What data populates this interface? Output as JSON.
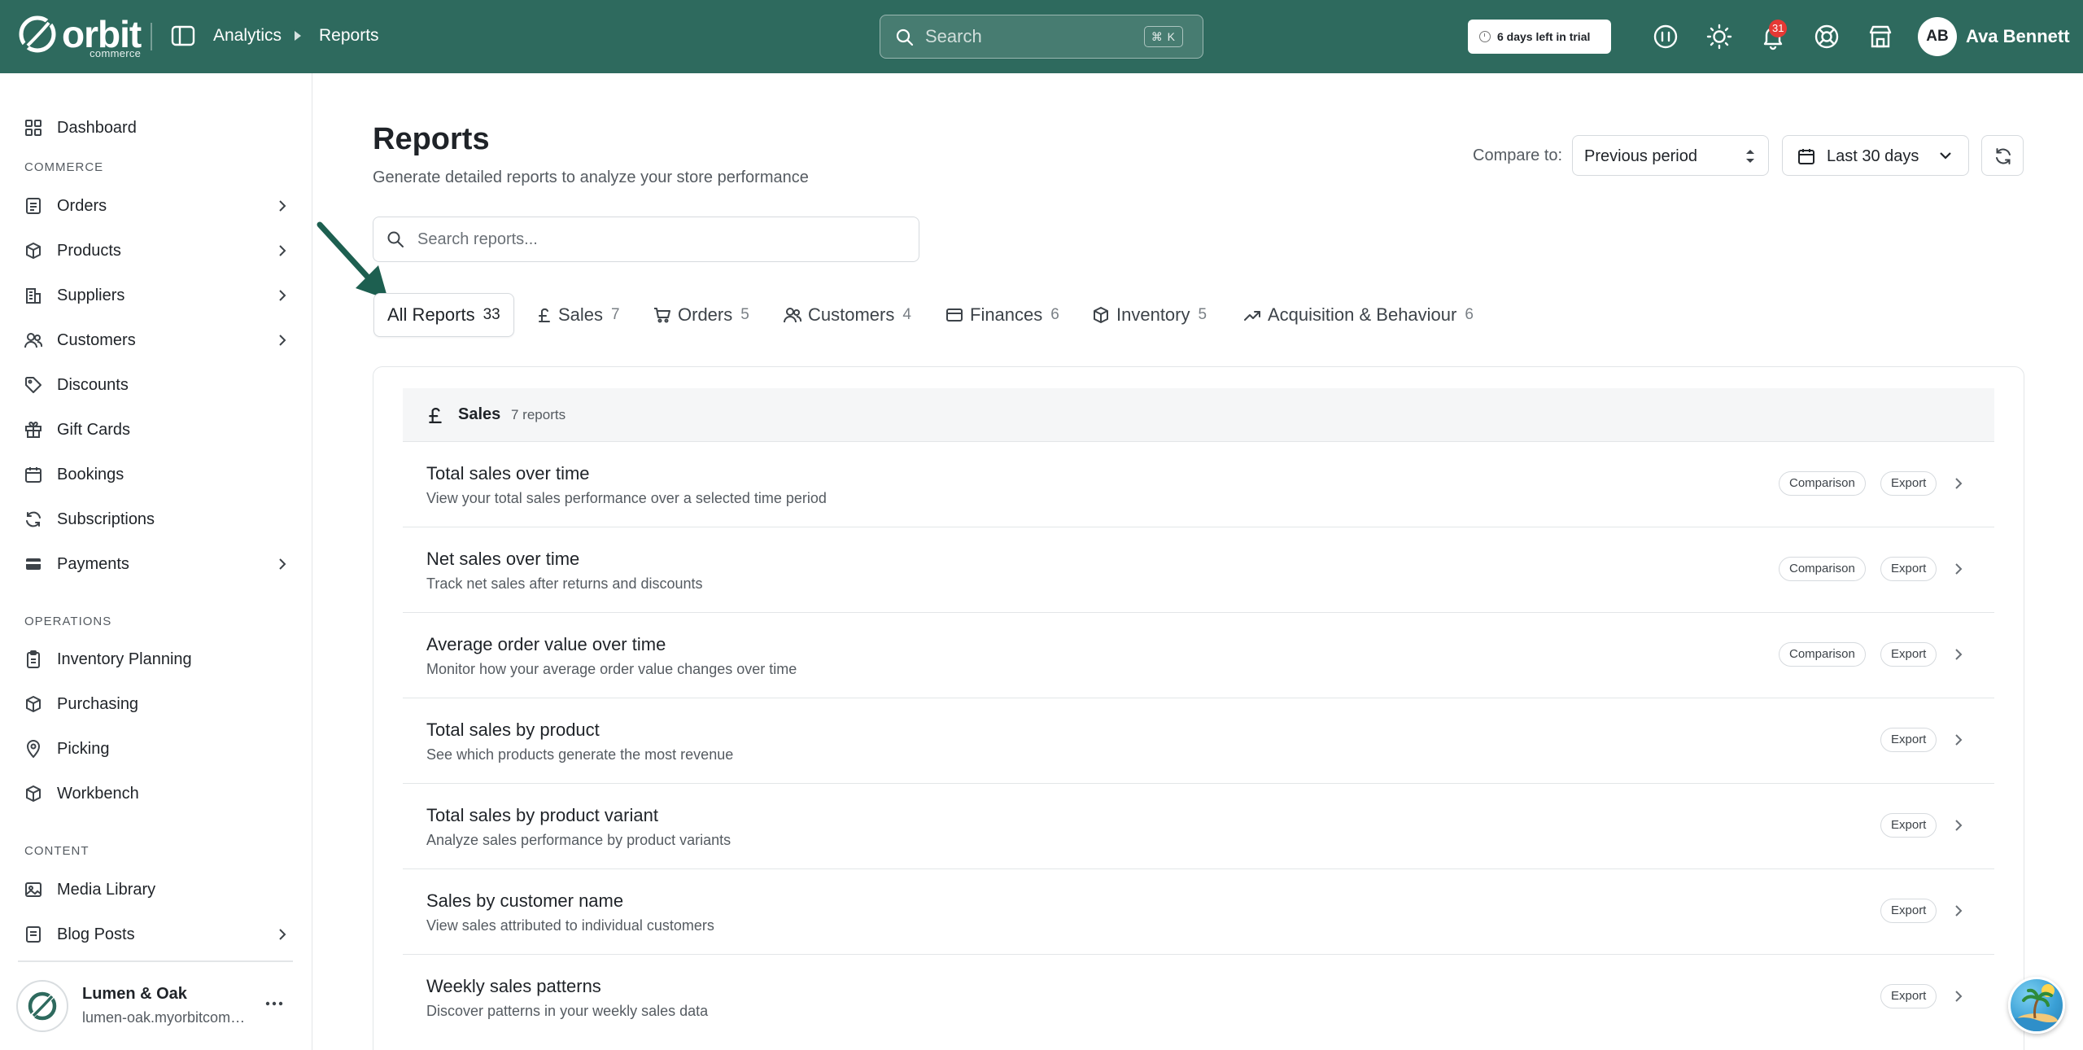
{
  "brand": {
    "name": "orbit",
    "sub": "commerce"
  },
  "breadcrumb": {
    "section": "Analytics",
    "page": "Reports"
  },
  "search": {
    "placeholder": "Search",
    "shortcut": "⌘ K"
  },
  "trial": {
    "text": "6 days left in trial"
  },
  "notifications": {
    "count": "31"
  },
  "user": {
    "initials": "AB",
    "name": "Ava Bennett"
  },
  "icons": {
    "topbar": [
      "sidebar-toggle-icon",
      "support-icon",
      "theme-sun-icon",
      "bell-icon",
      "help-lifebuoy-icon",
      "store-icon"
    ]
  },
  "sidebar": {
    "dashboard": "Dashboard",
    "sections": {
      "commerce": "COMMERCE",
      "operations": "OPERATIONS",
      "content": "CONTENT"
    },
    "commerce_items": [
      "Orders",
      "Products",
      "Suppliers",
      "Customers",
      "Discounts",
      "Gift Cards",
      "Bookings",
      "Subscriptions",
      "Payments"
    ],
    "operations_items": [
      "Inventory Planning",
      "Purchasing",
      "Picking",
      "Workbench"
    ],
    "content_items": [
      "Media Library",
      "Blog Posts"
    ],
    "store": {
      "name": "Lumen & Oak",
      "url": "lumen-oak.myorbitcommerce.com"
    }
  },
  "page": {
    "title": "Reports",
    "subtitle": "Generate detailed reports to analyze your store performance",
    "compare_label": "Compare to:",
    "compare_value": "Previous period",
    "date_range": "Last 30 days",
    "search_placeholder": "Search reports..."
  },
  "tabs": [
    {
      "label": "All Reports",
      "count": "33"
    },
    {
      "label": "Sales",
      "count": "7"
    },
    {
      "label": "Orders",
      "count": "5"
    },
    {
      "label": "Customers",
      "count": "4"
    },
    {
      "label": "Finances",
      "count": "6"
    },
    {
      "label": "Inventory",
      "count": "5"
    },
    {
      "label": "Acquisition & Behaviour",
      "count": "6"
    }
  ],
  "group": {
    "title": "Sales",
    "count": "7 reports"
  },
  "badges": {
    "comparison": "Comparison",
    "export": "Export"
  },
  "reports": [
    {
      "title": "Total sales over time",
      "desc": "View your total sales performance over a selected time period"
    },
    {
      "title": "Net sales over time",
      "desc": "Track net sales after returns and discounts"
    },
    {
      "title": "Average order value over time",
      "desc": "Monitor how your average order value changes over time"
    },
    {
      "title": "Total sales by product",
      "desc": "See which products generate the most revenue"
    },
    {
      "title": "Total sales by product variant",
      "desc": "Analyze sales performance by product variants"
    },
    {
      "title": "Sales by customer name",
      "desc": "View sales attributed to individual customers"
    },
    {
      "title": "Weekly sales patterns",
      "desc": "Discover patterns in your weekly sales data"
    }
  ],
  "colors": {
    "topbar": "#2e6a5e",
    "accent": "#1d5f50",
    "badge": "#e53935"
  }
}
